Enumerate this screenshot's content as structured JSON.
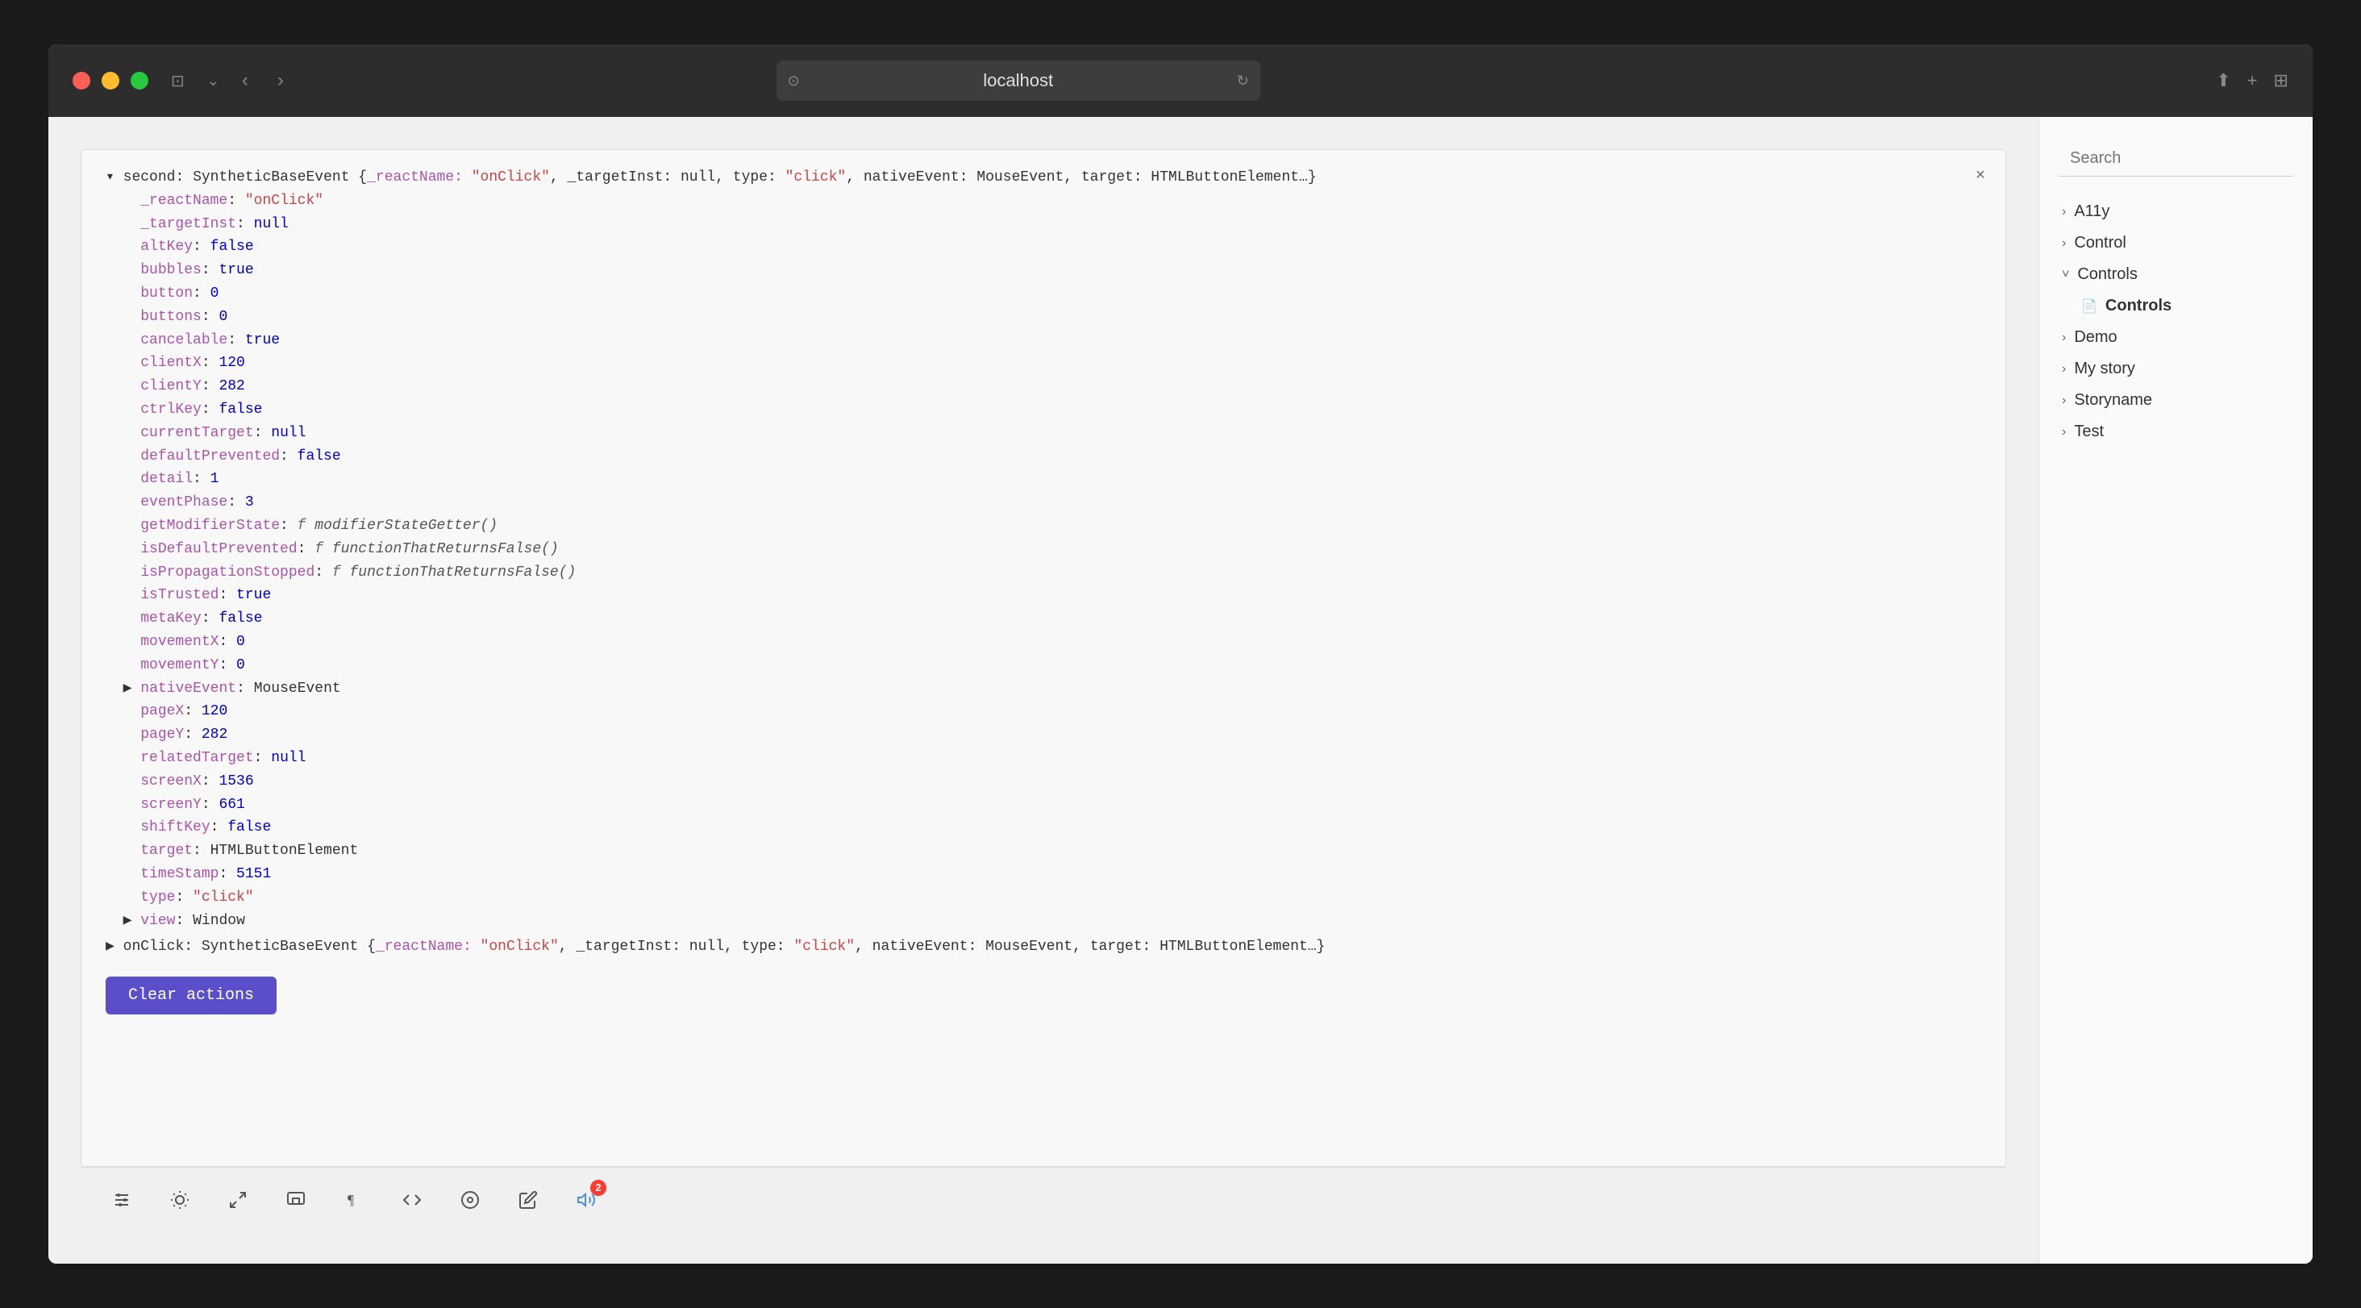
{
  "browser": {
    "url": "localhost",
    "traffic_lights": {
      "red": "#ff5f57",
      "yellow": "#febc2e",
      "green": "#28c840"
    }
  },
  "sidebar": {
    "search_placeholder": "Search",
    "items": [
      {
        "id": "a11y",
        "label": "A11y",
        "expanded": false,
        "active": false
      },
      {
        "id": "control",
        "label": "Control",
        "expanded": false,
        "active": false
      },
      {
        "id": "controls",
        "label": "Controls",
        "expanded": true,
        "active": false
      },
      {
        "id": "controls-file",
        "label": "Controls",
        "file": true,
        "active": true
      },
      {
        "id": "demo",
        "label": "Demo",
        "expanded": false,
        "active": false
      },
      {
        "id": "my-story",
        "label": "My story",
        "expanded": false,
        "active": false
      },
      {
        "id": "storyname",
        "label": "Storyname",
        "expanded": false,
        "active": false
      },
      {
        "id": "test",
        "label": "Test",
        "expanded": false,
        "active": false
      }
    ]
  },
  "code_panel": {
    "close_label": "×",
    "header_line": "▾ second: SyntheticBaseEvent {_reactName: \"onClick\", _targetInst: null, type: \"click\", nativeEvent: MouseEvent, target: HTMLButtonElement…}",
    "lines": [
      {
        "key": "_reactName",
        "value": "\"onClick\"",
        "type": "string"
      },
      {
        "key": "_targetInst",
        "value": "null",
        "type": "null"
      },
      {
        "key": "altKey",
        "value": "false",
        "type": "bool"
      },
      {
        "key": "bubbles",
        "value": "true",
        "type": "bool"
      },
      {
        "key": "button",
        "value": "0",
        "type": "num"
      },
      {
        "key": "buttons",
        "value": "0",
        "type": "num"
      },
      {
        "key": "cancelable",
        "value": "true",
        "type": "bool"
      },
      {
        "key": "clientX",
        "value": "120",
        "type": "num"
      },
      {
        "key": "clientY",
        "value": "282",
        "type": "num"
      },
      {
        "key": "ctrlKey",
        "value": "false",
        "type": "bool"
      },
      {
        "key": "currentTarget",
        "value": "null",
        "type": "null"
      },
      {
        "key": "defaultPrevented",
        "value": "false",
        "type": "bool"
      },
      {
        "key": "detail",
        "value": "1",
        "type": "num"
      },
      {
        "key": "eventPhase",
        "value": "3",
        "type": "num"
      },
      {
        "key": "getModifierState",
        "value": "f modifierStateGetter()",
        "type": "func"
      },
      {
        "key": "isDefaultPrevented",
        "value": "f functionThatReturnsFalse()",
        "type": "func"
      },
      {
        "key": "isPropagationStopped",
        "value": "f functionThatReturnsFalse()",
        "type": "func"
      },
      {
        "key": "isTrusted",
        "value": "true",
        "type": "bool"
      },
      {
        "key": "metaKey",
        "value": "false",
        "type": "bool"
      },
      {
        "key": "movementX",
        "value": "0",
        "type": "num"
      },
      {
        "key": "movementY",
        "value": "0",
        "type": "num"
      },
      {
        "key": "nativeEvent",
        "value": "MouseEvent",
        "type": "collapsed",
        "arrow": "▶"
      },
      {
        "key": "pageX",
        "value": "120",
        "type": "num"
      },
      {
        "key": "pageY",
        "value": "282",
        "type": "num"
      },
      {
        "key": "relatedTarget",
        "value": "null",
        "type": "null"
      },
      {
        "key": "screenX",
        "value": "1536",
        "type": "num"
      },
      {
        "key": "screenY",
        "value": "661",
        "type": "num"
      },
      {
        "key": "shiftKey",
        "value": "false",
        "type": "bool"
      },
      {
        "key": "target",
        "value": "HTMLButtonElement",
        "type": "label"
      },
      {
        "key": "timeStamp",
        "value": "5151",
        "type": "num"
      },
      {
        "key": "type",
        "value": "\"click\"",
        "type": "string"
      },
      {
        "key": "view",
        "value": "Window",
        "type": "label",
        "arrow": "▶"
      }
    ],
    "footer_line": "▶ onClick: SyntheticBaseEvent {_reactName: \"onClick\", _targetInst: null, type: \"click\", nativeEvent: MouseEvent, target: HTMLButtonElement…}",
    "clear_button_label": "Clear actions"
  },
  "toolbar": {
    "icons": [
      {
        "id": "controls-icon",
        "symbol": "⚙",
        "label": "Controls"
      },
      {
        "id": "light-icon",
        "symbol": "☀",
        "label": "Light"
      },
      {
        "id": "fullscreen-icon",
        "symbol": "⤢",
        "label": "Fullscreen"
      },
      {
        "id": "viewport-icon",
        "symbol": "⬚",
        "label": "Viewport"
      },
      {
        "id": "paragraph-icon",
        "symbol": "¶",
        "label": "Backgrounds"
      },
      {
        "id": "code-icon",
        "symbol": "⟨/⟩",
        "label": "Code"
      },
      {
        "id": "accessibility-icon",
        "symbol": "⊙",
        "label": "Accessibility"
      },
      {
        "id": "tool-icon",
        "symbol": "↩",
        "label": "Tool"
      },
      {
        "id": "actions-icon",
        "symbol": "📢",
        "label": "Actions",
        "active": true,
        "badge": "2"
      }
    ]
  }
}
